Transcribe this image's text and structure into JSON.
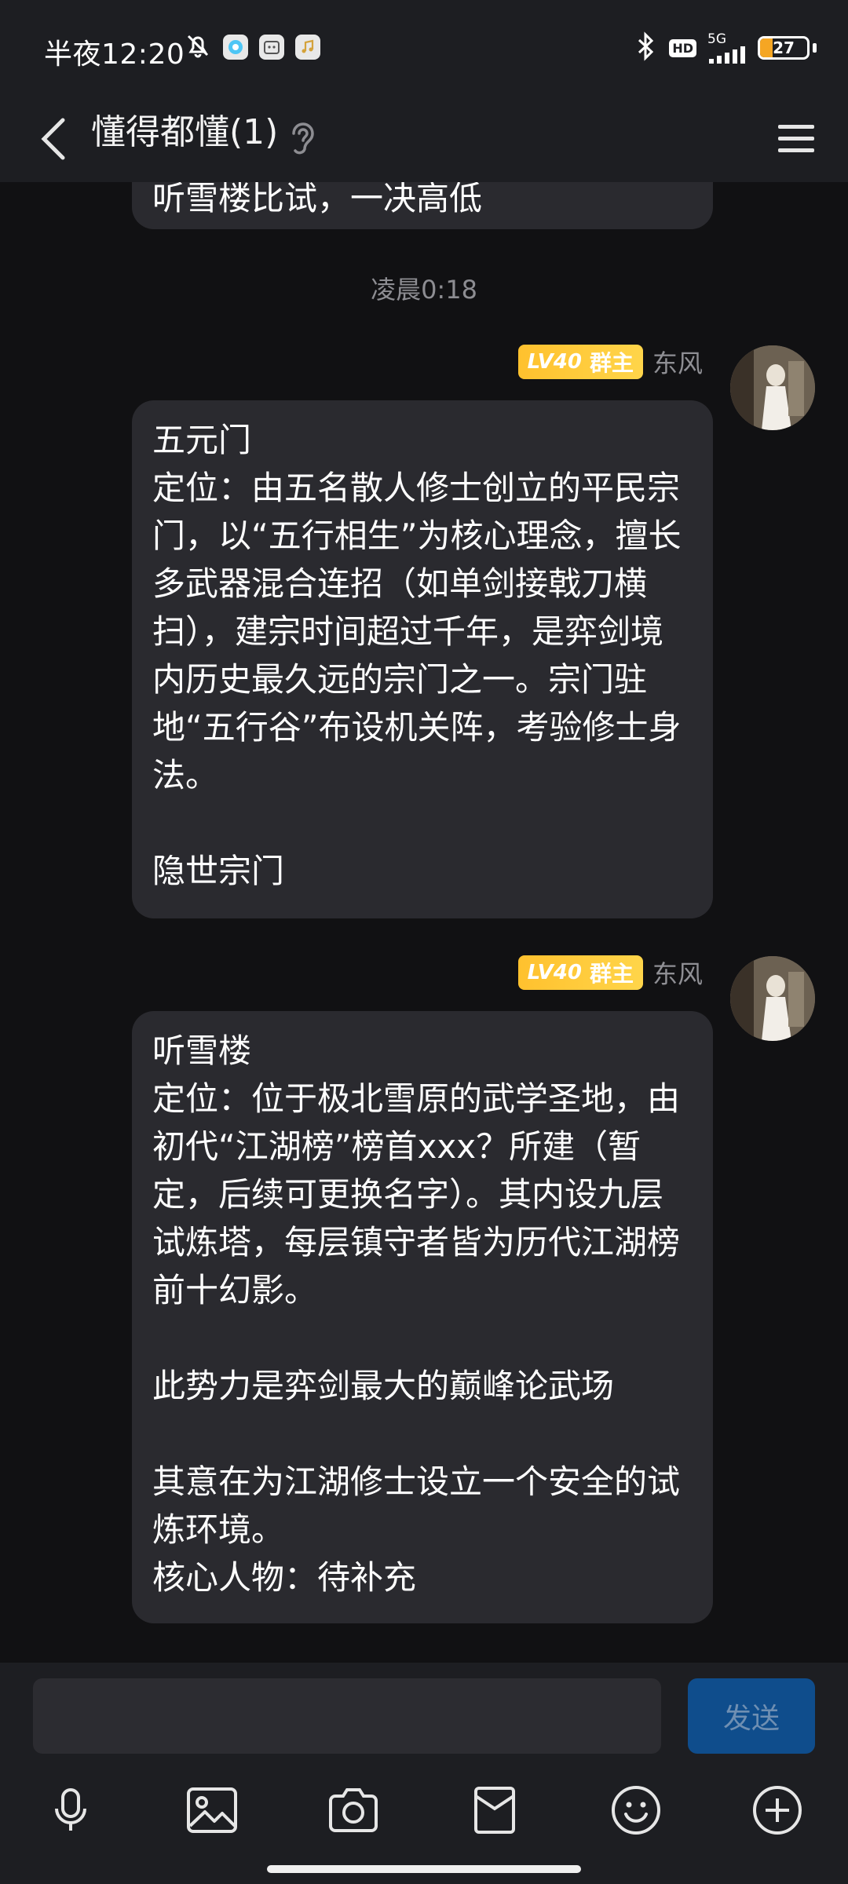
{
  "status_bar": {
    "time": "半夜12:20",
    "network": "5G",
    "hd": "HD",
    "battery": "27",
    "battery_level": 0.27
  },
  "header": {
    "title": "懂得都懂(1)"
  },
  "messages": {
    "top_partial": "听雪楼比试，一决高低",
    "timestamp": "凌晨0:18",
    "m1": {
      "badge_level": "LV40",
      "badge_role": "群主",
      "sender": "东风",
      "text": "五元门\n定位：由五名散人修士创立的平民宗门，以“五行相生”为核心理念，擅长多武器混合连招（如单剑接戟刀横扫），建宗时间超过千年，是弈剑境内历史最久远的宗门之一。宗门驻地“五行谷”布设机关阵，考验修士身法。\n\n隐世宗门"
    },
    "m2": {
      "badge_level": "LV40",
      "badge_role": "群主",
      "sender": "东风",
      "text": "听雪楼\n定位：位于极北雪原的武学圣地，由初代“江湖榜”榜首xxx？所建（暂定，后续可更换名字）。其内设九层试炼塔，每层镇守者皆为历代江湖榜前十幻影。\n\n此势力是弈剑最大的巅峰论武场\n\n其意在为江湖修士设立一个安全的试炼环境。\n核心人物：待补充"
    }
  },
  "input": {
    "value": "",
    "send_label": "发送"
  },
  "toolbar": {
    "icons": [
      "microphone-icon",
      "image-icon",
      "camera-icon",
      "red-packet-icon",
      "emoji-icon",
      "plus-icon"
    ]
  },
  "colors": {
    "background": "#111113",
    "bar": "#1d1e22",
    "bubble": "#2a2a2f",
    "badge": "#ffc12e",
    "send_button": "#0f4d8c"
  }
}
